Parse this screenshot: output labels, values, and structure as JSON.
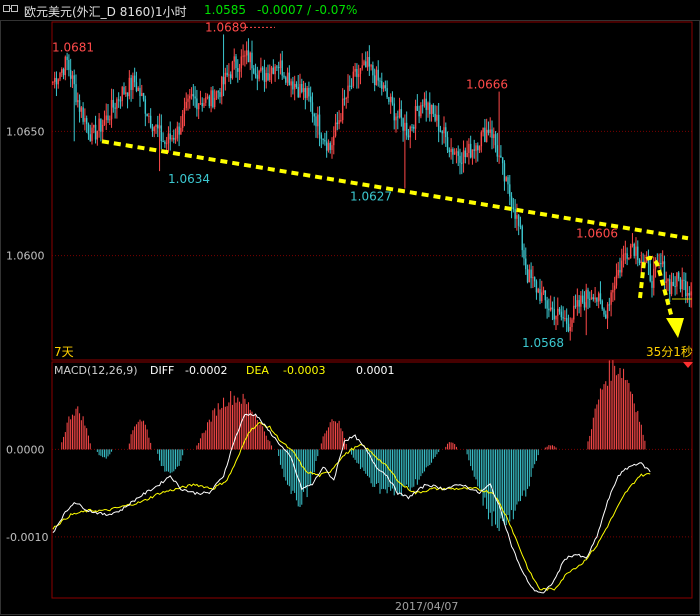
{
  "header": {
    "symbol_label": "欧元美元(外汇_D 8160)1小时",
    "last_price": "1.0585",
    "change_text": "-0.0007 / -0.07%"
  },
  "colors": {
    "up": "#ff4a4a",
    "down": "#3cc8d0",
    "price_label_up": "#ff4a4a",
    "price_label_down": "#3cc8d0",
    "grid": "#7a0000",
    "frame": "#8b0000",
    "trendline": "#ffff00",
    "diff": "#ffffff",
    "dea": "#ffff00",
    "axis_text": "#c0c0c0"
  },
  "chart_data": [
    {
      "type": "candlestick",
      "title": "欧元美元(外汇_D 8160)1小时",
      "ylim": [
        1.0558,
        1.0694
      ],
      "y_ticks": [
        "1.0650",
        "1.0600"
      ],
      "y_tick_values": [
        1.065,
        1.06
      ],
      "period_label": "7天",
      "countdown_label": "35分1秒",
      "annotations": [
        {
          "text": "1.0681",
          "value": 1.0681,
          "kind": "high"
        },
        {
          "text": "1.0689",
          "value": 1.0689,
          "kind": "high"
        },
        {
          "text": "1.0666",
          "value": 1.0666,
          "kind": "high"
        },
        {
          "text": "1.0606",
          "value": 1.0606,
          "kind": "high"
        },
        {
          "text": "1.0634",
          "value": 1.0634,
          "kind": "low"
        },
        {
          "text": "1.0627",
          "value": 1.0627,
          "kind": "low"
        },
        {
          "text": "1.0568",
          "value": 1.0568,
          "kind": "low"
        }
      ],
      "trendline": {
        "from": 1.0646,
        "to": 1.0607,
        "style": "dashed"
      },
      "close_anchors": [
        [
          0,
          1.067
        ],
        [
          8,
          1.0678
        ],
        [
          15,
          1.066
        ],
        [
          22,
          1.0648
        ],
        [
          30,
          1.0655
        ],
        [
          38,
          1.0665
        ],
        [
          46,
          1.067
        ],
        [
          55,
          1.0655
        ],
        [
          63,
          1.0645
        ],
        [
          70,
          1.065
        ],
        [
          78,
          1.0663
        ],
        [
          88,
          1.0662
        ],
        [
          95,
          1.0668
        ],
        [
          102,
          1.0677
        ],
        [
          110,
          1.068
        ],
        [
          118,
          1.0672
        ],
        [
          126,
          1.0678
        ],
        [
          135,
          1.067
        ],
        [
          143,
          1.0664
        ],
        [
          150,
          1.0652
        ],
        [
          156,
          1.0643
        ],
        [
          163,
          1.066
        ],
        [
          170,
          1.0672
        ],
        [
          177,
          1.0676
        ],
        [
          185,
          1.0668
        ],
        [
          192,
          1.0658
        ],
        [
          200,
          1.065
        ],
        [
          208,
          1.0663
        ],
        [
          216,
          1.0654
        ],
        [
          224,
          1.0643
        ],
        [
          232,
          1.064
        ],
        [
          240,
          1.0647
        ],
        [
          246,
          1.0652
        ],
        [
          250,
          1.0642
        ],
        [
          255,
          1.0628
        ],
        [
          259,
          1.0621
        ],
        [
          263,
          1.0608
        ],
        [
          267,
          1.0592
        ],
        [
          272,
          1.0587
        ],
        [
          278,
          1.058
        ],
        [
          284,
          1.0576
        ],
        [
          290,
          1.0573
        ],
        [
          297,
          1.0581
        ],
        [
          304,
          1.0586
        ],
        [
          310,
          1.0576
        ],
        [
          316,
          1.059
        ],
        [
          322,
          1.0601
        ],
        [
          326,
          1.0605
        ],
        [
          332,
          1.0598
        ],
        [
          337,
          1.0591
        ],
        [
          342,
          1.0596
        ],
        [
          347,
          1.0588
        ],
        [
          352,
          1.059
        ],
        [
          357,
          1.0587
        ]
      ],
      "spikes": [
        {
          "x": 96,
          "high": 1.0689
        },
        {
          "x": 198,
          "low": 1.0627
        },
        {
          "x": 251,
          "high": 1.0666
        },
        {
          "x": 300,
          "low": 1.0568
        },
        {
          "x": 322,
          "high": 1.0606
        },
        {
          "x": 12,
          "low": 1.0646
        },
        {
          "x": 60,
          "low": 1.0634
        }
      ]
    },
    {
      "type": "macd",
      "title": "MACD(12,26,9)",
      "series": [
        {
          "name": "DIFF",
          "last_value": "-0.0002"
        },
        {
          "name": "DEA",
          "last_value": "-0.0003"
        },
        {
          "name": "MACD",
          "last_value": "0.0001"
        }
      ],
      "ylim": [
        -0.0017,
        0.001
      ],
      "y_ticks": [
        "0.0000",
        "-0.0010"
      ],
      "y_tick_values": [
        0,
        -0.001
      ],
      "date_label": "2017/04/07",
      "diff_anchors": [
        [
          0,
          -0.00095
        ],
        [
          6,
          -0.00075
        ],
        [
          12,
          -0.0006
        ],
        [
          20,
          -0.0007
        ],
        [
          30,
          -0.00075
        ],
        [
          38,
          -0.0007
        ],
        [
          48,
          -0.00055
        ],
        [
          60,
          -0.0004
        ],
        [
          66,
          -0.0003
        ],
        [
          72,
          -0.00045
        ],
        [
          80,
          -0.0005
        ],
        [
          88,
          -0.0005
        ],
        [
          96,
          -0.0003
        ],
        [
          102,
          0.0001
        ],
        [
          108,
          0.0004
        ],
        [
          114,
          0.0004
        ],
        [
          120,
          0.00025
        ],
        [
          126,
          0.0001
        ],
        [
          134,
          -0.0001
        ],
        [
          140,
          -0.00045
        ],
        [
          146,
          -0.0004
        ],
        [
          152,
          -0.0002
        ],
        [
          158,
          -0.00035
        ],
        [
          164,
          0.0001
        ],
        [
          170,
          0.00015
        ],
        [
          176,
          0.0
        ],
        [
          182,
          -0.0002
        ],
        [
          188,
          -0.0003
        ],
        [
          194,
          -0.0005
        ],
        [
          200,
          -0.00055
        ],
        [
          210,
          -0.0004
        ],
        [
          220,
          -0.00045
        ],
        [
          230,
          -0.0004
        ],
        [
          240,
          -0.0005
        ],
        [
          246,
          -0.0004
        ],
        [
          252,
          -0.0007
        ],
        [
          258,
          -0.0011
        ],
        [
          264,
          -0.0014
        ],
        [
          270,
          -0.0016
        ],
        [
          276,
          -0.00165
        ],
        [
          282,
          -0.0015
        ],
        [
          288,
          -0.00125
        ],
        [
          294,
          -0.0012
        ],
        [
          300,
          -0.00125
        ],
        [
          306,
          -0.001
        ],
        [
          312,
          -0.0006
        ],
        [
          318,
          -0.0003
        ],
        [
          324,
          -0.0002
        ],
        [
          330,
          -0.00015
        ],
        [
          336,
          -0.00025
        ]
      ],
      "dea_anchors": [
        [
          0,
          -0.0009
        ],
        [
          10,
          -0.00075
        ],
        [
          20,
          -0.0007
        ],
        [
          30,
          -0.0007
        ],
        [
          40,
          -0.00065
        ],
        [
          50,
          -0.0006
        ],
        [
          60,
          -0.0005
        ],
        [
          70,
          -0.00045
        ],
        [
          80,
          -0.0004
        ],
        [
          90,
          -0.00045
        ],
        [
          98,
          -0.00035
        ],
        [
          104,
          -0.0001
        ],
        [
          110,
          0.0002
        ],
        [
          116,
          0.0003
        ],
        [
          122,
          0.00025
        ],
        [
          128,
          0.0001
        ],
        [
          136,
          -5e-05
        ],
        [
          142,
          -0.00025
        ],
        [
          150,
          -0.0003
        ],
        [
          156,
          -0.00025
        ],
        [
          162,
          -0.0001
        ],
        [
          168,
          0.0
        ],
        [
          174,
          5e-05
        ],
        [
          180,
          -5e-05
        ],
        [
          188,
          -0.0002
        ],
        [
          196,
          -0.0004
        ],
        [
          204,
          -0.0005
        ],
        [
          214,
          -0.00045
        ],
        [
          226,
          -0.00045
        ],
        [
          238,
          -0.00045
        ],
        [
          248,
          -0.0005
        ],
        [
          256,
          -0.0008
        ],
        [
          262,
          -0.0011
        ],
        [
          268,
          -0.0014
        ],
        [
          274,
          -0.0016
        ],
        [
          282,
          -0.0016
        ],
        [
          290,
          -0.0014
        ],
        [
          298,
          -0.0013
        ],
        [
          306,
          -0.0011
        ],
        [
          314,
          -0.0008
        ],
        [
          322,
          -0.0005
        ],
        [
          330,
          -0.0003
        ],
        [
          336,
          -0.00028
        ]
      ],
      "hist_groups": [
        {
          "from": 4,
          "to": 22,
          "peak": 0.00045,
          "sign": 1
        },
        {
          "from": 24,
          "to": 34,
          "peak": -0.0001,
          "sign": -1
        },
        {
          "from": 42,
          "to": 56,
          "peak": 0.00035,
          "sign": 1
        },
        {
          "from": 58,
          "to": 74,
          "peak": -0.0003,
          "sign": -1
        },
        {
          "from": 80,
          "to": 124,
          "peak": 0.0006,
          "sign": 1
        },
        {
          "from": 126,
          "to": 150,
          "peak": -0.0006,
          "sign": -1
        },
        {
          "from": 150,
          "to": 166,
          "peak": 0.00035,
          "sign": 1
        },
        {
          "from": 166,
          "to": 218,
          "peak": -0.0005,
          "sign": -1
        },
        {
          "from": 220,
          "to": 228,
          "peak": 8e-05,
          "sign": 1
        },
        {
          "from": 232,
          "to": 274,
          "peak": -0.00085,
          "sign": -1
        },
        {
          "from": 276,
          "to": 284,
          "peak": 5e-05,
          "sign": 1
        },
        {
          "from": 300,
          "to": 334,
          "peak": 0.00095,
          "sign": 1
        }
      ]
    }
  ]
}
